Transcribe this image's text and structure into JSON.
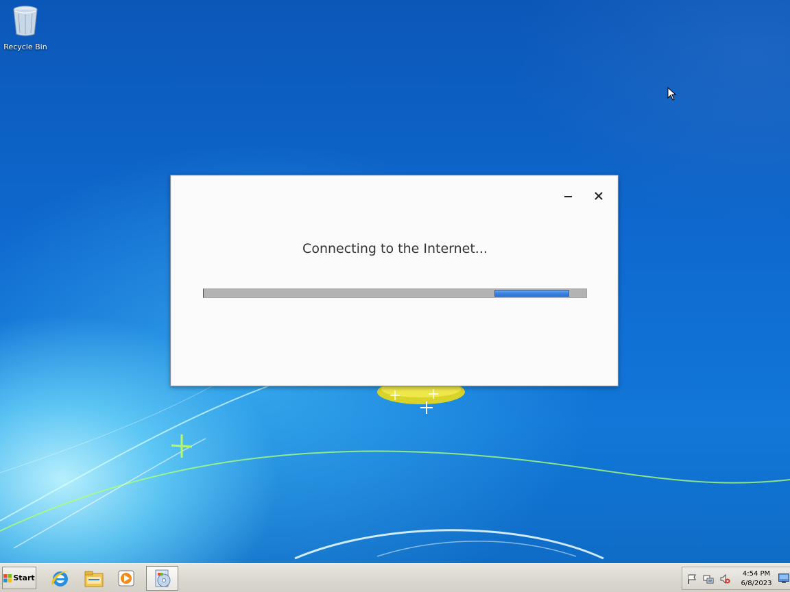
{
  "desktop": {
    "icons": [
      {
        "label": "Recycle Bin",
        "icon": "recycle-bin-icon"
      }
    ]
  },
  "dialog": {
    "message": "Connecting to the Internet...",
    "minimize_icon": "minimize-icon",
    "close_icon": "close-icon",
    "progress": {
      "fill_start_fraction": 0.76,
      "fill_end_fraction": 0.955,
      "track_color": "#b3b3b3",
      "fill_color": "#3b86e4"
    }
  },
  "taskbar": {
    "start_label": "Start",
    "pinned_apps": [
      {
        "icon": "internet-explorer-icon"
      },
      {
        "icon": "windows-explorer-icon"
      },
      {
        "icon": "windows-media-player-icon"
      },
      {
        "icon": "setup-disc-icon",
        "active": true
      }
    ],
    "tray": {
      "icons": [
        "action-center-flag-icon",
        "network-icon",
        "volume-muted-icon"
      ],
      "time": "4:54 PM",
      "date": "6/8/2023",
      "show_desktop_icon": "show-desktop-icon"
    }
  },
  "colors": {
    "desktop_blue": "#0f6ad0",
    "taskbar_gray": "#d4d0c8",
    "dialog_bg": "#fbfbfb",
    "progress_blue": "#3b86e4"
  }
}
